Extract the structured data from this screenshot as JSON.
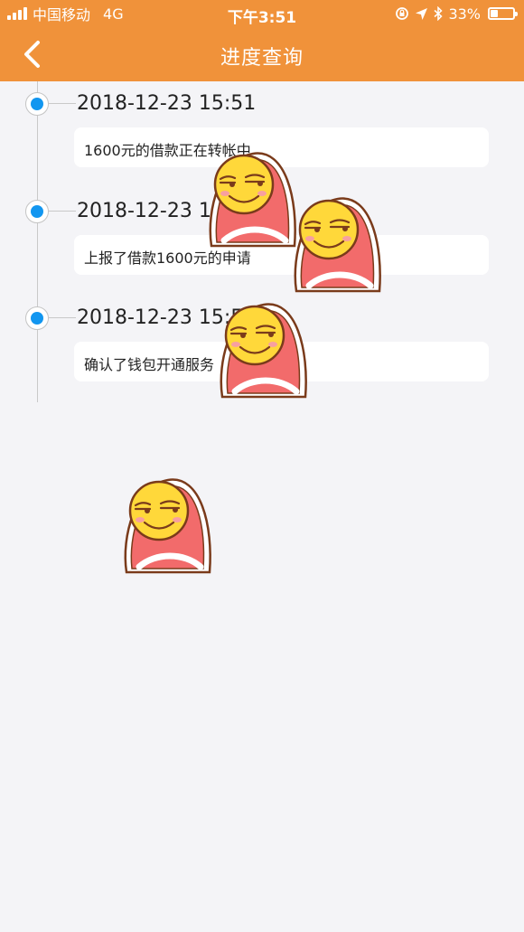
{
  "status_bar": {
    "carrier": "中国移动",
    "network": "4G",
    "time": "下午3:51",
    "battery_text": "33%",
    "battery_level": 0.33
  },
  "nav": {
    "title": "进度查询"
  },
  "timeline": [
    {
      "time": "2018-12-23 15:51",
      "message": "1600元的借款正在转帐中"
    },
    {
      "time": "2018-12-23 15:51",
      "message": "上报了借款1600元的申请"
    },
    {
      "time": "2018-12-23 15:51",
      "message": "确认了钱包开通服务"
    }
  ],
  "colors": {
    "header": "#f0923a",
    "dot": "#1296f0",
    "background": "#f4f4f7"
  },
  "icons": {
    "back": "chevron-left-icon",
    "location": "location-arrow-icon",
    "bluetooth": "bluetooth-icon",
    "lock": "rotation-lock-icon",
    "sticker": "blanket-smiley-sticker"
  }
}
